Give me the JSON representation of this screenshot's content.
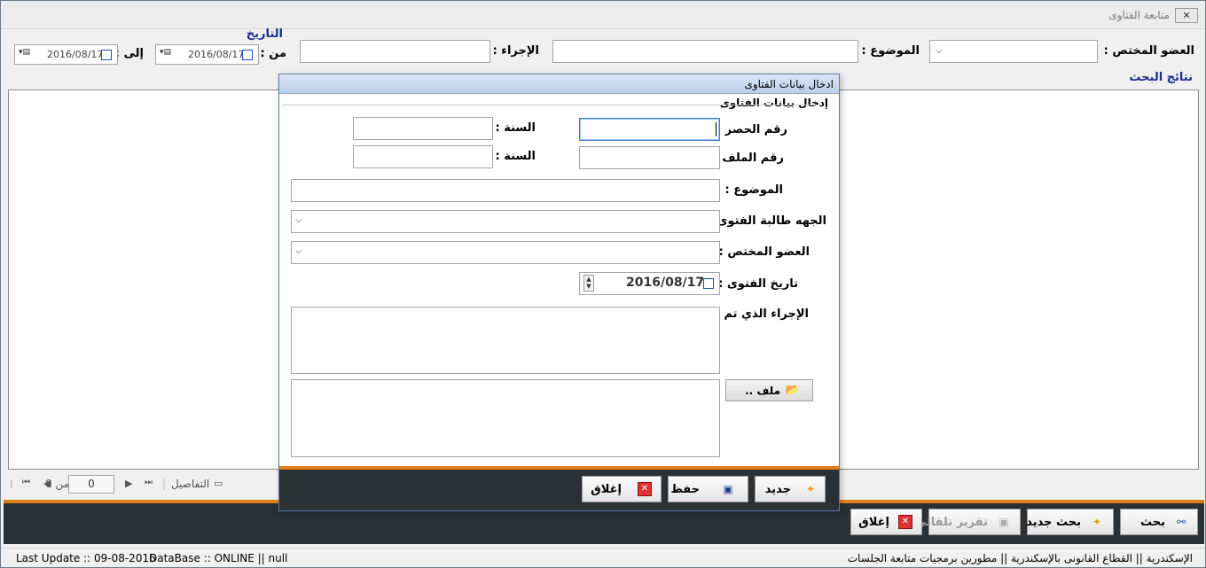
{
  "window": {
    "title": "متابعة الفتاوى",
    "close_label": "✕"
  },
  "filters": {
    "member_label": "العضو المختص :",
    "subject_label": "الموضوع :",
    "action_label": "الإجراء :",
    "date_group_label": "التاريخ",
    "from_label": "من :",
    "to_label": "إلى :",
    "from_date": "2016/08/17",
    "to_date": "2016/08/17"
  },
  "results": {
    "title": "نتائج البحث"
  },
  "navigator": {
    "of_label": "من 0",
    "page_value": "0",
    "details_label": "التفاصيل"
  },
  "toolbar": {
    "search_label": "بحث",
    "new_search_label": "بحث جديد",
    "auto_report_label": "تقرير تلقائى",
    "close_label": "إغلاق"
  },
  "status": {
    "last_update": "Last Update :: 09-08-2016",
    "database": "DataBase :: ONLINE || null",
    "right_text": "الإسكندرية || القطاع القانونى بالإسكندرية || مطورين برمجيات  متابعة الجلسات"
  },
  "dialog": {
    "title": "ادخال بيانات الفتاوى",
    "group_label": "إدخال بيانات الفتاوى",
    "inventory_no_label": "رقم الحصر :",
    "year_label_1": "السنة :",
    "file_no_label": "رقم الملف :",
    "year_label_2": "السنة :",
    "subject_label": "الموضوع :",
    "requesting_party_label": "الجهه طالبة الفتوى :",
    "member_label": "العضو المختص :",
    "fatwa_date_label": "تاريخ الفتوى :",
    "fatwa_date_value": "2016/08/17",
    "action_taken_label": "الإجراء الذي تم :",
    "file_button_label": "ملف ..",
    "new_label": "جديد",
    "save_label": "حفظ",
    "close_label": "إغلاق"
  },
  "colors": {
    "accent_orange": "#e07e16",
    "toolbar_dark": "#2b3035",
    "section_blue": "#1a2c8c"
  }
}
